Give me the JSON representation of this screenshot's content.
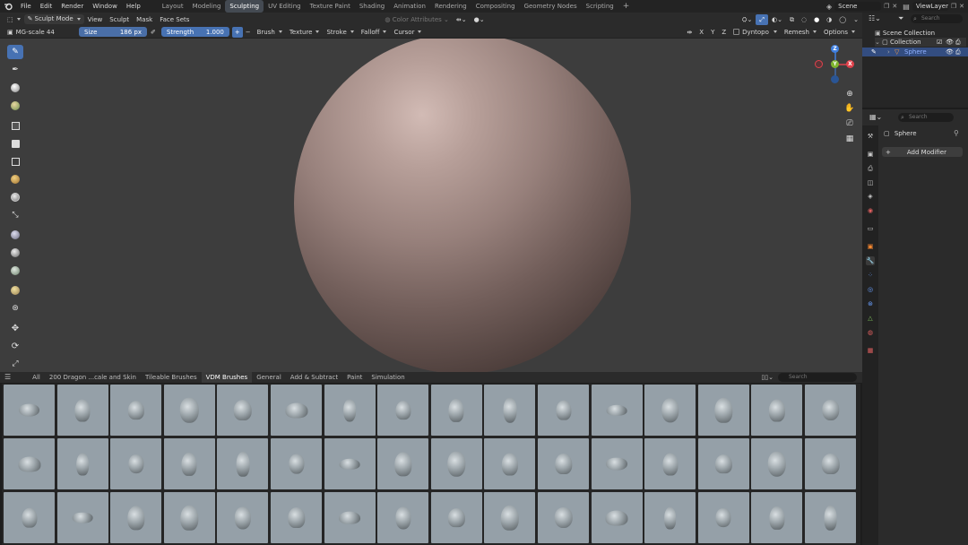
{
  "menubar": {
    "menus": [
      "File",
      "Edit",
      "Render",
      "Window",
      "Help"
    ],
    "workspaces": [
      "Layout",
      "Modeling",
      "Sculpting",
      "UV Editing",
      "Texture Paint",
      "Shading",
      "Animation",
      "Rendering",
      "Compositing",
      "Geometry Nodes",
      "Scripting"
    ],
    "active_workspace": "Sculpting",
    "scene": "Scene",
    "view_layer": "ViewLayer"
  },
  "header": {
    "mode": "Sculpt Mode",
    "menus": [
      "View",
      "Sculpt",
      "Mask",
      "Face Sets"
    ],
    "color_attributes": "Color Attributes",
    "brush_name": "MG-scale 44",
    "size_label": "Size",
    "size_value": "186 px",
    "strength_label": "Strength",
    "strength_value": "1.000",
    "dropdowns": [
      "Brush",
      "Texture",
      "Stroke",
      "Falloff",
      "Cursor"
    ],
    "axes": [
      "X",
      "Y",
      "Z"
    ],
    "dyntopo": "Dyntopo",
    "remesh": "Remesh",
    "options": "Options"
  },
  "gizmo": {
    "z": "Z",
    "x": "X",
    "y": "Y"
  },
  "asset_browser": {
    "tabs": [
      "All",
      "200 Dragon ...cale and Skin",
      "Tileable Brushes",
      "VDM Brushes",
      "General",
      "Add & Subtract",
      "Paint",
      "Simulation"
    ],
    "active_tab": "VDM Brushes",
    "search_placeholder": "Search"
  },
  "outliner": {
    "search_placeholder": "Search",
    "scene_collection": "Scene Collection",
    "collection": "Collection",
    "object": "Sphere"
  },
  "properties": {
    "search_placeholder": "Search",
    "object": "Sphere",
    "add_modifier": "Add Modifier"
  },
  "colors": {
    "accent": "#4772b3",
    "viewport_bg": "#3d3d3d",
    "panel_bg": "#2b2b2b",
    "thumb_bg": "#95a0a8",
    "gizmo_x": "#e0424c",
    "gizmo_y": "#7fb52e",
    "gizmo_z": "#3f7fdf"
  }
}
